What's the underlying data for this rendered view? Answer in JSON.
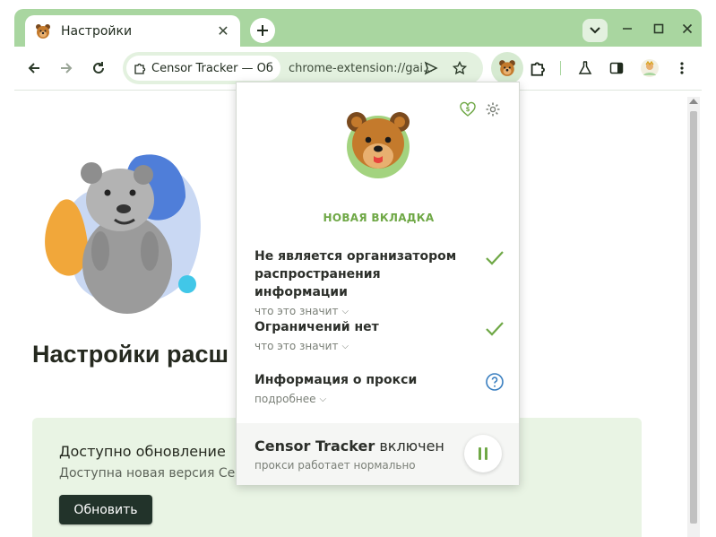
{
  "browser": {
    "tab": {
      "title": "Настройки",
      "close_icon": "close-icon"
    },
    "omnibox": {
      "site_chip": "Censor Tracker — Об",
      "url": "chrome-extension://gai..."
    }
  },
  "page": {
    "title": "Настройки расш",
    "update": {
      "title": "Доступно обновление",
      "description": "Доступна новая версия Censo",
      "button": "Обновить"
    }
  },
  "popup": {
    "tab_name": "НОВАЯ ВКЛАДКА",
    "items": [
      {
        "title": "Не является организатором распространения информации",
        "link": "что это значит",
        "status": "ok"
      },
      {
        "title": "Ограничений нет",
        "link": "что это значит",
        "status": "ok"
      },
      {
        "title": "Информация о прокси",
        "link": "подробнее",
        "status": "info"
      }
    ],
    "footer": {
      "brand": "Censor Tracker",
      "state": "включен",
      "subtitle": "прокси работает нормально"
    }
  },
  "colors": {
    "frame": "#a9d6a0",
    "accent_green": "#6fa846",
    "info_blue": "#3a7fc0",
    "button_dark": "#22332a"
  }
}
